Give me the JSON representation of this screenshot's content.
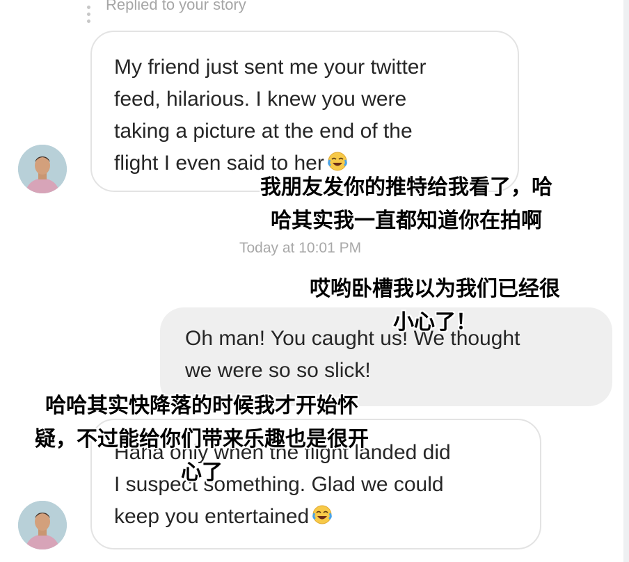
{
  "story_reply": {
    "label": "Replied to your story"
  },
  "messages": [
    {
      "sender": "other",
      "lines": [
        "My friend just sent me your twitter",
        "feed, hilarious. I knew you were",
        "taking a picture at the end of the",
        "flight I even said to her"
      ],
      "emoji": "face-with-tears-of-joy-emoji"
    },
    {
      "sender": "me",
      "lines": [
        "Oh man! You caught us! We thought",
        "we were so so slick!"
      ]
    },
    {
      "sender": "other",
      "lines": [
        "Haha only when the flight landed did",
        "I suspect something. Glad we could",
        "keep you entertained"
      ],
      "emoji": "face-with-tears-of-joy-emoji"
    }
  ],
  "timestamp": "Today at 10:01 PM",
  "captions": [
    {
      "lines": [
        "我朋友发你的推特给我看了，哈",
        "哈其实我一直都知道你在拍啊"
      ]
    },
    {
      "lines": [
        "哎哟卧槽我以为我们已经很",
        "小心了！"
      ]
    },
    {
      "lines": [
        "哈哈其实快降落的时候我才开始怀",
        "疑，不过能给你们带来乐趣也是很开",
        "心了"
      ]
    }
  ],
  "colors": {
    "incoming_bubble_border": "#e3e3e3",
    "outgoing_bubble_bg": "#efefef",
    "text": "#262626",
    "meta_text": "#a8a8a8",
    "caption_text": "#000000"
  }
}
